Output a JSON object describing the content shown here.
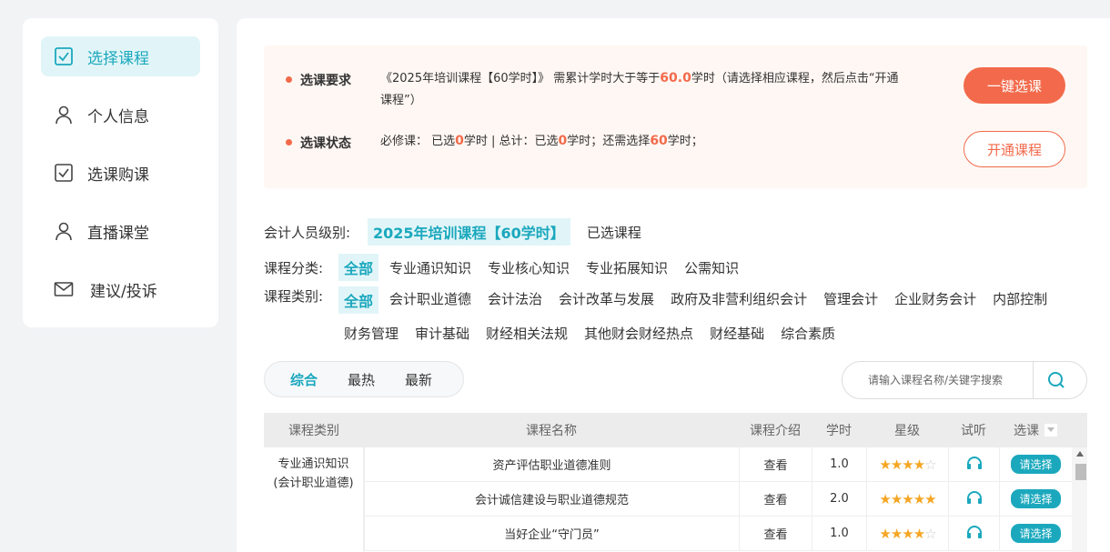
{
  "sidebar": {
    "items": [
      {
        "label": "选择课程",
        "icon": "checkbox-icon",
        "active": true
      },
      {
        "label": "个人信息",
        "icon": "user-icon",
        "active": false
      },
      {
        "label": "选课购课",
        "icon": "checkbox-icon",
        "active": false
      },
      {
        "label": "直播课堂",
        "icon": "user-icon",
        "active": false
      },
      {
        "label": "建议/投诉",
        "icon": "mail-icon",
        "active": false
      }
    ]
  },
  "requirement": {
    "label": "选课要求",
    "text_pre": "《2025年培训课程【60学时】》 需累计学时大于等于",
    "hours": "60.0",
    "text_post": "学时（请选择相应课程，然后点击“开通",
    "text_line2": "课程”）"
  },
  "status": {
    "label": "选课状态",
    "t1": "必修课： 已选",
    "v1": "0",
    "t2": "学时 | 总计：已选",
    "v2": "0",
    "t3": "学时；还需选择",
    "v3": "60",
    "t4": "学时；"
  },
  "buttons": {
    "one_click": "一键选课",
    "open": "开通课程"
  },
  "level": {
    "label": "会计人员级别:",
    "options": [
      "2025年培训课程【60学时】",
      "已选课程"
    ]
  },
  "category": {
    "label": "课程分类:",
    "options": [
      "全部",
      "专业通识知识",
      "专业核心知识",
      "专业拓展知识",
      "公需知识"
    ]
  },
  "type": {
    "label": "课程类别:",
    "options": [
      "全部",
      "会计职业道德",
      "会计法治",
      "会计改革与发展",
      "政府及非营利组织会计",
      "管理会计",
      "企业财务会计",
      "内部控制",
      "财务管理",
      "审计基础",
      "财经相关法规",
      "其他财会财经热点",
      "财经基础",
      "综合素质"
    ]
  },
  "sort": {
    "tabs": [
      "综合",
      "最热",
      "最新"
    ]
  },
  "search": {
    "placeholder": "请输入课程名称/关键字搜索"
  },
  "table": {
    "headers": [
      "课程类别",
      "课程名称",
      "课程介绍",
      "学时",
      "星级",
      "试听",
      "选课"
    ],
    "category_line1": "专业通识知识",
    "category_line2": "(会计职业道德)",
    "rows": [
      {
        "name": "资产评估职业道德准则",
        "intro": "查看",
        "hours": "1.0",
        "stars": 4,
        "pick": "请选择"
      },
      {
        "name": "会计诚信建设与职业道德规范",
        "intro": "查看",
        "hours": "2.0",
        "stars": 5,
        "pick": "请选择"
      },
      {
        "name": "当好企业“守门员”",
        "intro": "查看",
        "hours": "1.0",
        "stars": 4,
        "pick": "请选择"
      }
    ]
  },
  "colors": {
    "accent": "#1ba8bd",
    "orange": "#f26a4b",
    "star": "#f5a623"
  }
}
